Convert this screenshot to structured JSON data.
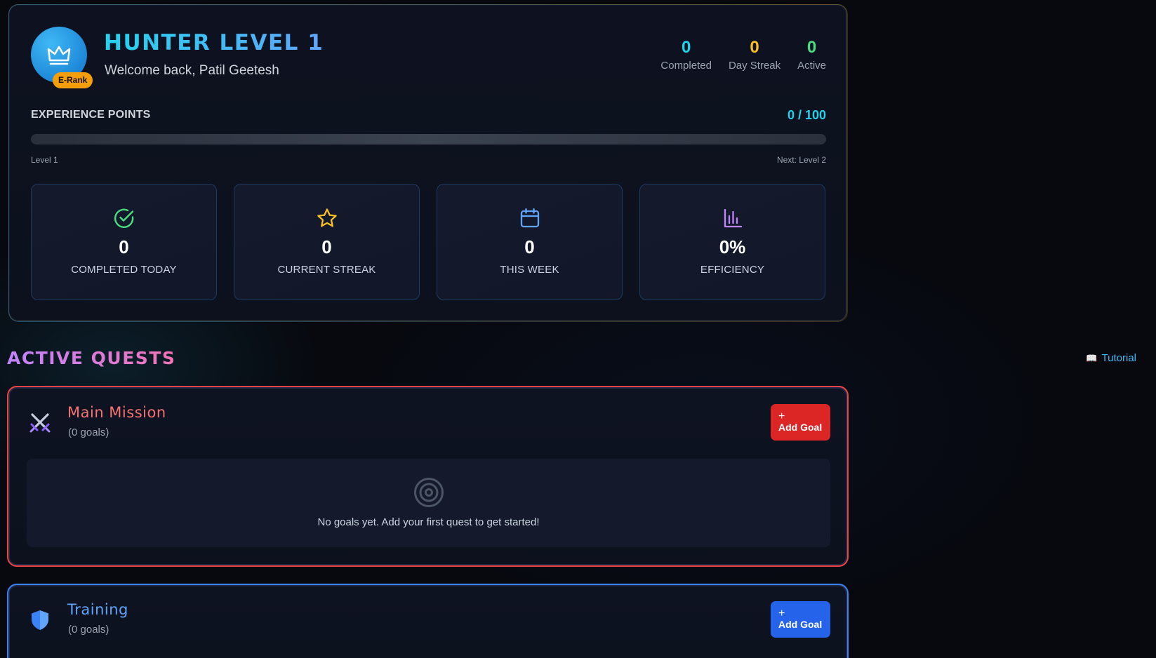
{
  "hero": {
    "rank_badge": "E-Rank",
    "title": "HUNTER LEVEL 1",
    "welcome": "Welcome back, Patil Geetesh",
    "top_stats": [
      {
        "value": "0",
        "label": "Completed",
        "color": "#22d3ee"
      },
      {
        "value": "0",
        "label": "Day Streak",
        "color": "#fbbf24"
      },
      {
        "value": "0",
        "label": "Active",
        "color": "#4ade80"
      }
    ],
    "xp": {
      "label": "EXPERIENCE POINTS",
      "value": "0 / 100",
      "progress_fraction": 0,
      "level_left": "Level 1",
      "level_right": "Next: Level 2"
    },
    "cards": [
      {
        "icon": "check-circle-icon",
        "value": "0",
        "caption": "COMPLETED TODAY",
        "color": "#4ade80"
      },
      {
        "icon": "star-icon",
        "value": "0",
        "caption": "CURRENT STREAK",
        "color": "#fbbf24"
      },
      {
        "icon": "calendar-icon",
        "value": "0",
        "caption": "THIS WEEK",
        "color": "#60a5fa"
      },
      {
        "icon": "bar-chart-icon",
        "value": "0%",
        "caption": "EFFICIENCY",
        "color": "#c084fc"
      }
    ]
  },
  "quests": {
    "section_title": "ACTIVE QUESTS",
    "tutorial_label": "Tutorial",
    "tutorial_icon": "book-icon",
    "main": {
      "icon": "crossed-swords-icon",
      "name": "Main Mission",
      "count": "(0 goals)",
      "add_label": "Add Goal",
      "color": "#f87171",
      "empty_icon": "target-icon",
      "empty_message": "No goals yet. Add your first quest to get started!"
    },
    "training": {
      "icon": "shield-icon",
      "name": "Training",
      "count": "(0 goals)",
      "add_label": "Add Goal",
      "color": "#60a5fa"
    }
  }
}
